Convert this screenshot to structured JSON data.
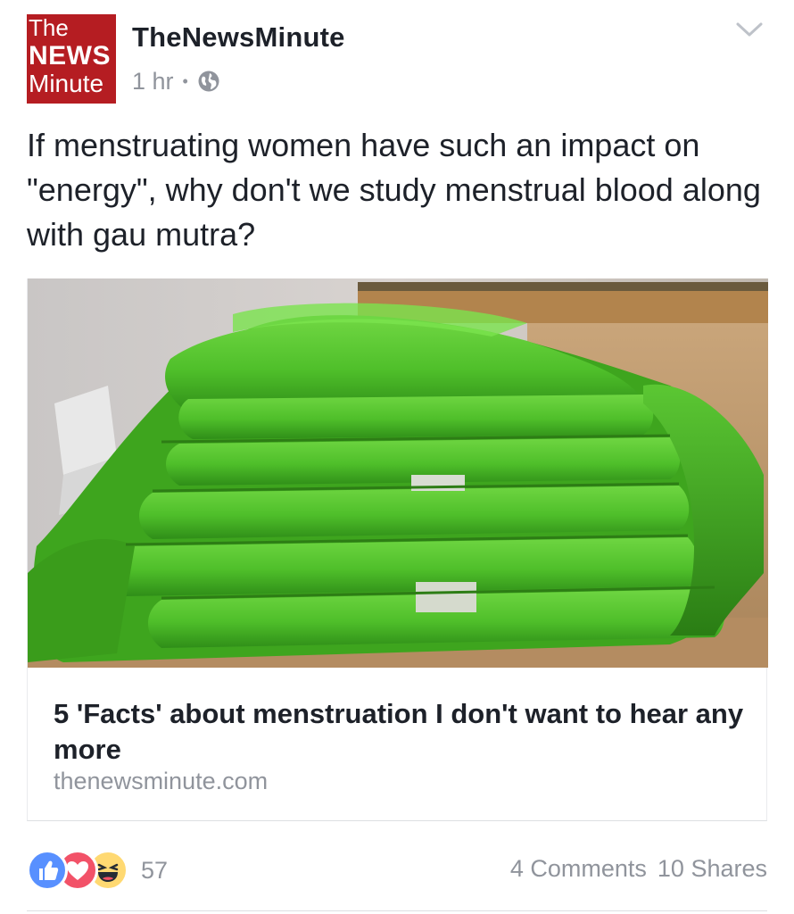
{
  "post": {
    "page": {
      "logo_lines": [
        "The",
        "NEWS",
        "Minute"
      ],
      "name": "TheNewsMinute"
    },
    "time": "1 hr",
    "separator": "•",
    "privacy_icon": "globe-icon",
    "menu_icon": "chevron-down-icon",
    "text": "If menstruating women have such an impact on \"energy\", why don't we study menstrual blood along with gau mutra?",
    "link": {
      "title": "5 'Facts' about menstruation I don't want to hear any more",
      "domain": "thenewsminute.com",
      "image_icon": "sanitary-pads-photo"
    },
    "reactions": {
      "types": [
        "like",
        "love",
        "haha"
      ],
      "count": "57"
    },
    "comments": "4 Comments",
    "shares": "10 Shares"
  },
  "colors": {
    "logo_red": "#b51d22",
    "meta_gray": "#90949c",
    "like_blue": "#5890ff",
    "love_red": "#f25268",
    "haha_yellow": "#ffd972",
    "pad_green": "#4fbf2a"
  }
}
